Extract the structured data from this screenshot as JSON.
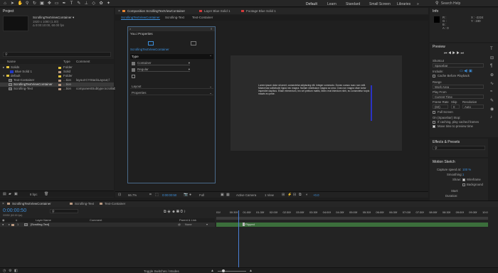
{
  "toolbar": {
    "search_label": "Search Help",
    "workspaces": [
      "Default",
      "Learn",
      "Standard",
      "Small Screen",
      "Libraries"
    ]
  },
  "project": {
    "title": "Project",
    "comp_name": "ScrollingTextViewContainer ▾",
    "comp_info1": "1920 x 1080 (1.00)",
    "comp_info2": "Δ 0:00:10:00, 60.00 fps",
    "columns": [
      "Name",
      "Type",
      "Comment"
    ],
    "items": [
      {
        "name": "Solids",
        "type": "Folder",
        "comment": "",
        "color": "#e3c33c",
        "indent": 0
      },
      {
        "name": "Blue Solid 1",
        "type": "Solid",
        "comment": "",
        "color": "#2238c8",
        "indent": 1
      },
      {
        "name": "default",
        "type": "Folder",
        "comment": "",
        "color": "#e3c33c",
        "indent": 0
      },
      {
        "name": "Text-Container",
        "type": "...tion",
        "comment": "layout:CYStackLayout,f",
        "color": "#b89880",
        "indent": 1
      },
      {
        "name": "ScrollingTextViewContainer",
        "type": "...tion",
        "comment": "",
        "color": "#b89880",
        "indent": 1
      },
      {
        "name": "Scrolling-Text",
        "type": "...tion",
        "comment": "componentSubtype:scrollab",
        "color": "#b89880",
        "indent": 1
      }
    ],
    "footer_bpc": "8 bpc"
  },
  "viewer": {
    "tabs": [
      "Composition ScrollingTextViewContainer",
      "Layer Blue Solid 1",
      "Footage Blue Solid 1"
    ],
    "subtabs": [
      "ScrollingTextViewContainer",
      "Scrolling-Text",
      "Text-Container"
    ],
    "body_text": "Lorem ipsum dolor sit amet, consectetur adipiscing elit. Integer commodo. Donec cursus nunc non velit. Maecenas sollicitudin ligula nec magna. Nullam vestibulum magna ac urna. Cras non magna vitae tortor imperdiet dapibus. Etiam elementum, leo vel pretium mattis, libero erat interdum nibh, eu consectetur turpis mauris eu pede.",
    "zoom": "66.7%",
    "timecode": "0:00:00:50",
    "resolution": "Full",
    "camera": "Active Camera",
    "views": "1 View",
    "exposure": "+0.0"
  },
  "props_panel": {
    "title": "You.i Properties",
    "comp": "ScrollingTextViewContainer",
    "type_label": "Type",
    "type_value": "Container",
    "subtype_value": "Regular",
    "layout_label": "Layout",
    "properties_label": "Properties"
  },
  "info": {
    "title": "Info",
    "r": "R :",
    "g": "G :",
    "b": "B :",
    "a": "A : 0",
    "x": "X : -2224",
    "y": "Y : 230"
  },
  "preview": {
    "title": "Preview",
    "shortcut_label": "Shortcut",
    "shortcut_value": "Spacebar",
    "include_label": "Include:",
    "cache_label": "Cache Before Playback",
    "range_label": "Range",
    "range_value": "Work Area",
    "play_from_label": "Play From",
    "play_from_value": "Current Time",
    "frame_rate_label": "Frame Rate",
    "skip_label": "Skip",
    "resolution_label": "Resolution",
    "frame_rate_value": "(60)",
    "skip_value": "0",
    "resolution_value": "Auto",
    "full_screen_label": "Full Screen",
    "stop_label": "On (Spacebar) Stop:",
    "if_caching_label": "If caching, play cached frames",
    "move_time_label": "Move time to preview time"
  },
  "effects": {
    "title": "Effects & Presets",
    "search_icon": "search-icon"
  },
  "motion_sketch": {
    "title": "Motion Sketch",
    "capture_label": "Capture speed at:",
    "capture_value": "100 %",
    "smoothing_label": "Smoothing:",
    "smoothing_value": "1",
    "show_label": "Show:",
    "wireframe_label": "Wireframe",
    "background_label": "Background",
    "start_label": "Start:",
    "duration_label": "Duration:"
  },
  "timeline": {
    "tabs": [
      "ScrollingTextViewContainer",
      "Scrolling-Text",
      "Text-Container"
    ],
    "timecode": "0:00:00:50",
    "timecode_sub": "00050 (60.00 fps)",
    "columns": [
      "Layer Name",
      "Comment",
      "Parent & Link"
    ],
    "layer_index": "1",
    "layer_name": "[Scrolling-Text]",
    "parent_value": "None",
    "ruler": [
      "01f",
      "00:30f",
      "01:00f",
      "01:30f",
      "02:00f",
      "02:30f",
      "03:00f",
      "03:30f",
      "04:00f",
      "04:30f",
      "05:00f",
      "05:30f",
      "06:00f",
      "06:30f",
      "07:00f",
      "07:30f",
      "08:00f",
      "08:30f",
      "09:00f",
      "09:30f",
      "10:0"
    ],
    "marker_label": "Flipped",
    "toggle_label": "Toggle Switches / Modes",
    "playhead_fraction": 0.08,
    "colors": {
      "bar": "#3b6e3b",
      "playhead": "#4a7fd6",
      "accent": "#3c8fdc"
    }
  }
}
